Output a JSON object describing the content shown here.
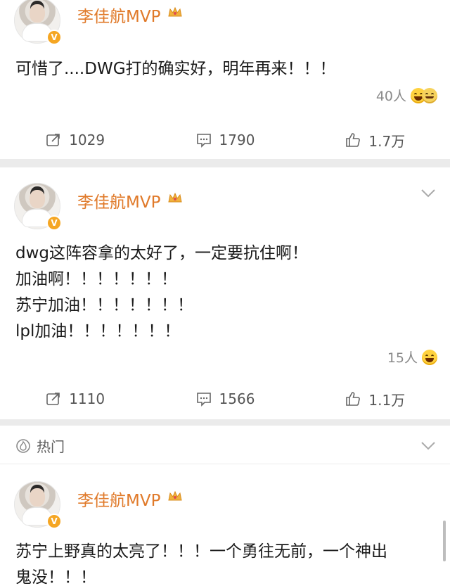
{
  "posts": [
    {
      "author": "李佳航MVP",
      "badge": "V",
      "lines": [
        "可惜了....DWG打的确实好，明年再来！！！"
      ],
      "reaction_count": "40人",
      "repost_count": "1029",
      "comment_count": "1790",
      "like_count": "1.7万",
      "has_more_menu": false
    },
    {
      "author": "李佳航MVP",
      "badge": "V",
      "lines": [
        "dwg这阵容拿的太好了，一定要抗住啊！",
        "加油啊！！！！！！！",
        "苏宁加油！！！！！！！",
        "lpl加油！！！！！！！"
      ],
      "reaction_count": "15人",
      "repost_count": "1110",
      "comment_count": "1566",
      "like_count": "1.1万",
      "has_more_menu": true
    },
    {
      "author": "李佳航MVP",
      "badge": "V",
      "lines": [
        "苏宁上野真的太亮了！！！一个勇往无前，一个神出",
        "鬼没！！！"
      ]
    }
  ],
  "section": {
    "label": "热门"
  },
  "colors": {
    "author_name": "#e07a2a",
    "verified_badge": "#f5a623",
    "background_gap": "#ebebeb"
  },
  "icons": {
    "repost": "repost-icon",
    "comment": "comment-icon",
    "like": "thumbs-up-icon",
    "crown": "crown-icon",
    "chevron": "chevron-down-icon",
    "hot": "hot-icon"
  }
}
